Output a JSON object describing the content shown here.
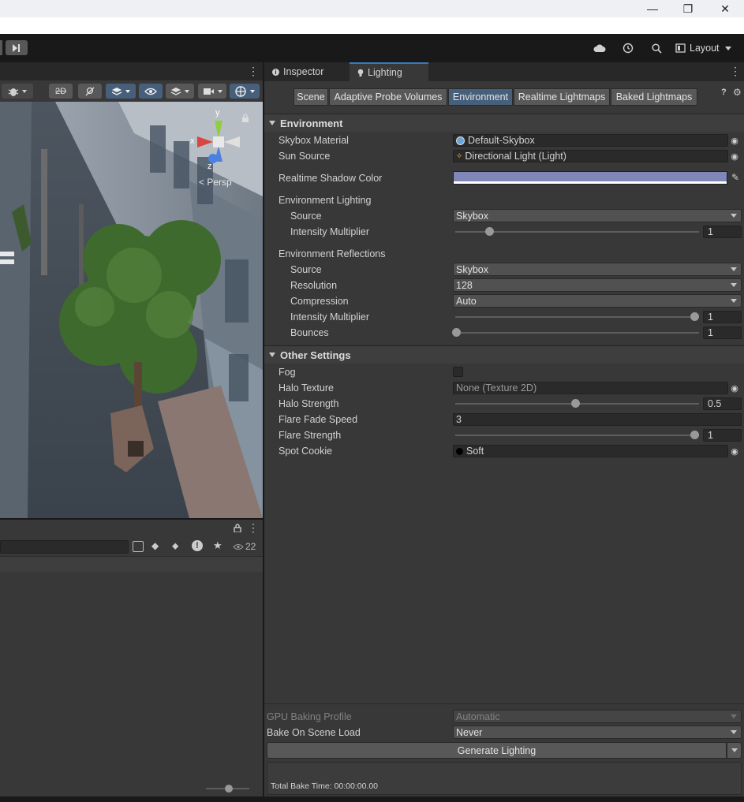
{
  "window": {
    "minimize_glyph": "—",
    "maximize_glyph": "❐",
    "close_glyph": "✕"
  },
  "toolbar": {
    "layout_label": "Layout",
    "icons": [
      "cloud-icon",
      "history-icon",
      "search-icon",
      "layout-icon"
    ]
  },
  "scene_view": {
    "persp_label": "< Persp",
    "gizmo_axes": {
      "x": "x",
      "y": "y",
      "z": "z"
    },
    "toolbar_2d_label": "2D"
  },
  "lower_panel": {
    "visible_count": "22"
  },
  "tabs": [
    {
      "label": "Inspector",
      "active": false
    },
    {
      "label": "Lighting",
      "active": true
    }
  ],
  "lighting_tabs": [
    {
      "label": "Scene",
      "active": false
    },
    {
      "label": "Adaptive Probe Volumes",
      "active": false
    },
    {
      "label": "Environment",
      "active": true
    },
    {
      "label": "Realtime Lightmaps",
      "active": false
    },
    {
      "label": "Baked Lightmaps",
      "active": false
    }
  ],
  "environment": {
    "header": "Environment",
    "skybox_material": {
      "label": "Skybox Material",
      "value": "Default-Skybox"
    },
    "sun_source": {
      "label": "Sun Source",
      "value": "Directional Light (Light)"
    },
    "realtime_shadow_color": {
      "label": "Realtime Shadow Color",
      "color": "#7f86b8"
    },
    "environment_lighting": {
      "label": "Environment Lighting",
      "source": {
        "label": "Source",
        "value": "Skybox"
      },
      "intensity": {
        "label": "Intensity Multiplier",
        "value": "1",
        "fraction": 0.14
      }
    },
    "environment_reflections": {
      "label": "Environment Reflections",
      "source": {
        "label": "Source",
        "value": "Skybox"
      },
      "resolution": {
        "label": "Resolution",
        "value": "128"
      },
      "compression": {
        "label": "Compression",
        "value": "Auto"
      },
      "intensity": {
        "label": "Intensity Multiplier",
        "value": "1",
        "fraction": 1.0
      },
      "bounces": {
        "label": "Bounces",
        "value": "1",
        "fraction": 0.0
      }
    }
  },
  "other_settings": {
    "header": "Other Settings",
    "fog": {
      "label": "Fog",
      "checked": false
    },
    "halo_texture": {
      "label": "Halo Texture",
      "value": "None (Texture 2D)"
    },
    "halo_strength": {
      "label": "Halo Strength",
      "value": "0.5",
      "fraction": 0.5
    },
    "flare_fade_speed": {
      "label": "Flare Fade Speed",
      "value": "3"
    },
    "flare_strength": {
      "label": "Flare Strength",
      "value": "1",
      "fraction": 1.0
    },
    "spot_cookie": {
      "label": "Spot Cookie",
      "value": "Soft"
    }
  },
  "bottom": {
    "gpu_baking_profile": {
      "label": "GPU Baking Profile",
      "value": "Automatic"
    },
    "bake_on_scene_load": {
      "label": "Bake On Scene Load",
      "value": "Never"
    },
    "generate_lighting": "Generate Lighting",
    "total_bake_time": "Total Bake Time: 00:00:00.00"
  }
}
